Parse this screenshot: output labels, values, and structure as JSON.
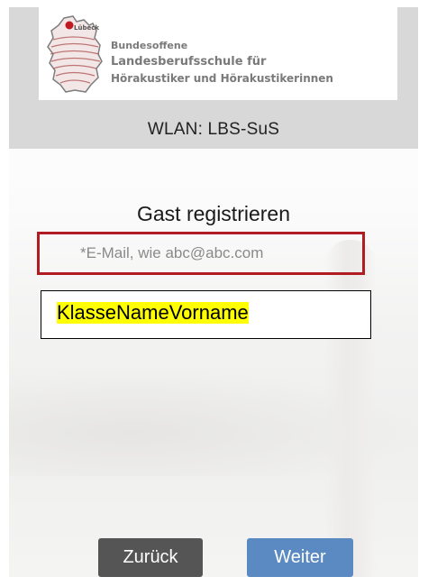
{
  "header": {
    "logo": {
      "map_label": "Lübeck",
      "line1": "Bundesoffene",
      "line2": "Landesberufsschule für",
      "line3": "Hörakustiker und Hörakustikerinnen"
    },
    "network": "WLAN: LBS-SuS"
  },
  "form": {
    "title": "Gast registrieren",
    "email": {
      "value": "",
      "placeholder": "*E-Mail, wie abc@abc.com"
    },
    "name_annotation": "KlasseNameVorname"
  },
  "buttons": {
    "back": "Zurück",
    "next": "Weiter"
  },
  "colors": {
    "header_bg": "#d8d8d8",
    "highlight_border": "#b01c22",
    "annotation_highlight": "#ffff00",
    "back_button": "#555555",
    "next_button": "#5b8ac2"
  }
}
